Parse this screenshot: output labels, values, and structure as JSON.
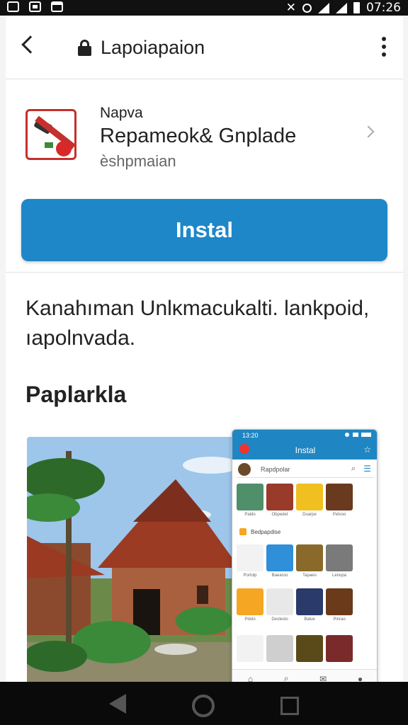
{
  "status_bar": {
    "time": "07:26",
    "left_icons": [
      "check-box-icon",
      "image-icon",
      "check-box-icon"
    ],
    "right_icons": [
      "mute-icon",
      "location-icon",
      "wifi-icon",
      "signal-icon",
      "battery-icon"
    ]
  },
  "app_bar": {
    "title": "Lapoiapaion",
    "icons": [
      "back-arrow-icon",
      "lock-icon",
      "more-vert-icon"
    ]
  },
  "listing": {
    "developer": "Napva",
    "app_name": "Repameok& Gnplade",
    "category": "ѐshpmaian",
    "install_label": "Instal",
    "description": "Kanahıman Unlκmacukalti. lankpoid, ıapolnvada.",
    "section_title": "Paplarkla"
  },
  "mini_app": {
    "time": "13:20",
    "title": "Instal",
    "search_placeholder": "Rapdpolar",
    "section_label": "Bedpapdise",
    "row1_captions": [
      "Paldo",
      "Obpedet",
      "Duarpe",
      "Pelxoo"
    ],
    "row2_captions": [
      "Portolp",
      "Baearoo",
      "Tapaeo",
      "Lenupa"
    ],
    "row3_captions": [
      "Pdolo",
      "Deoleslo",
      "Balue",
      "Pinrao"
    ],
    "nav_icons": [
      "home-icon",
      "search-icon",
      "inbox-icon",
      "profile-icon"
    ]
  },
  "system_nav": {
    "icons": [
      "back-triangle-icon",
      "home-circle-icon",
      "recents-square-icon"
    ]
  },
  "colors": {
    "install_button": "#1e87c8",
    "status_bar": "#111111",
    "accent_red": "#c4302b"
  }
}
